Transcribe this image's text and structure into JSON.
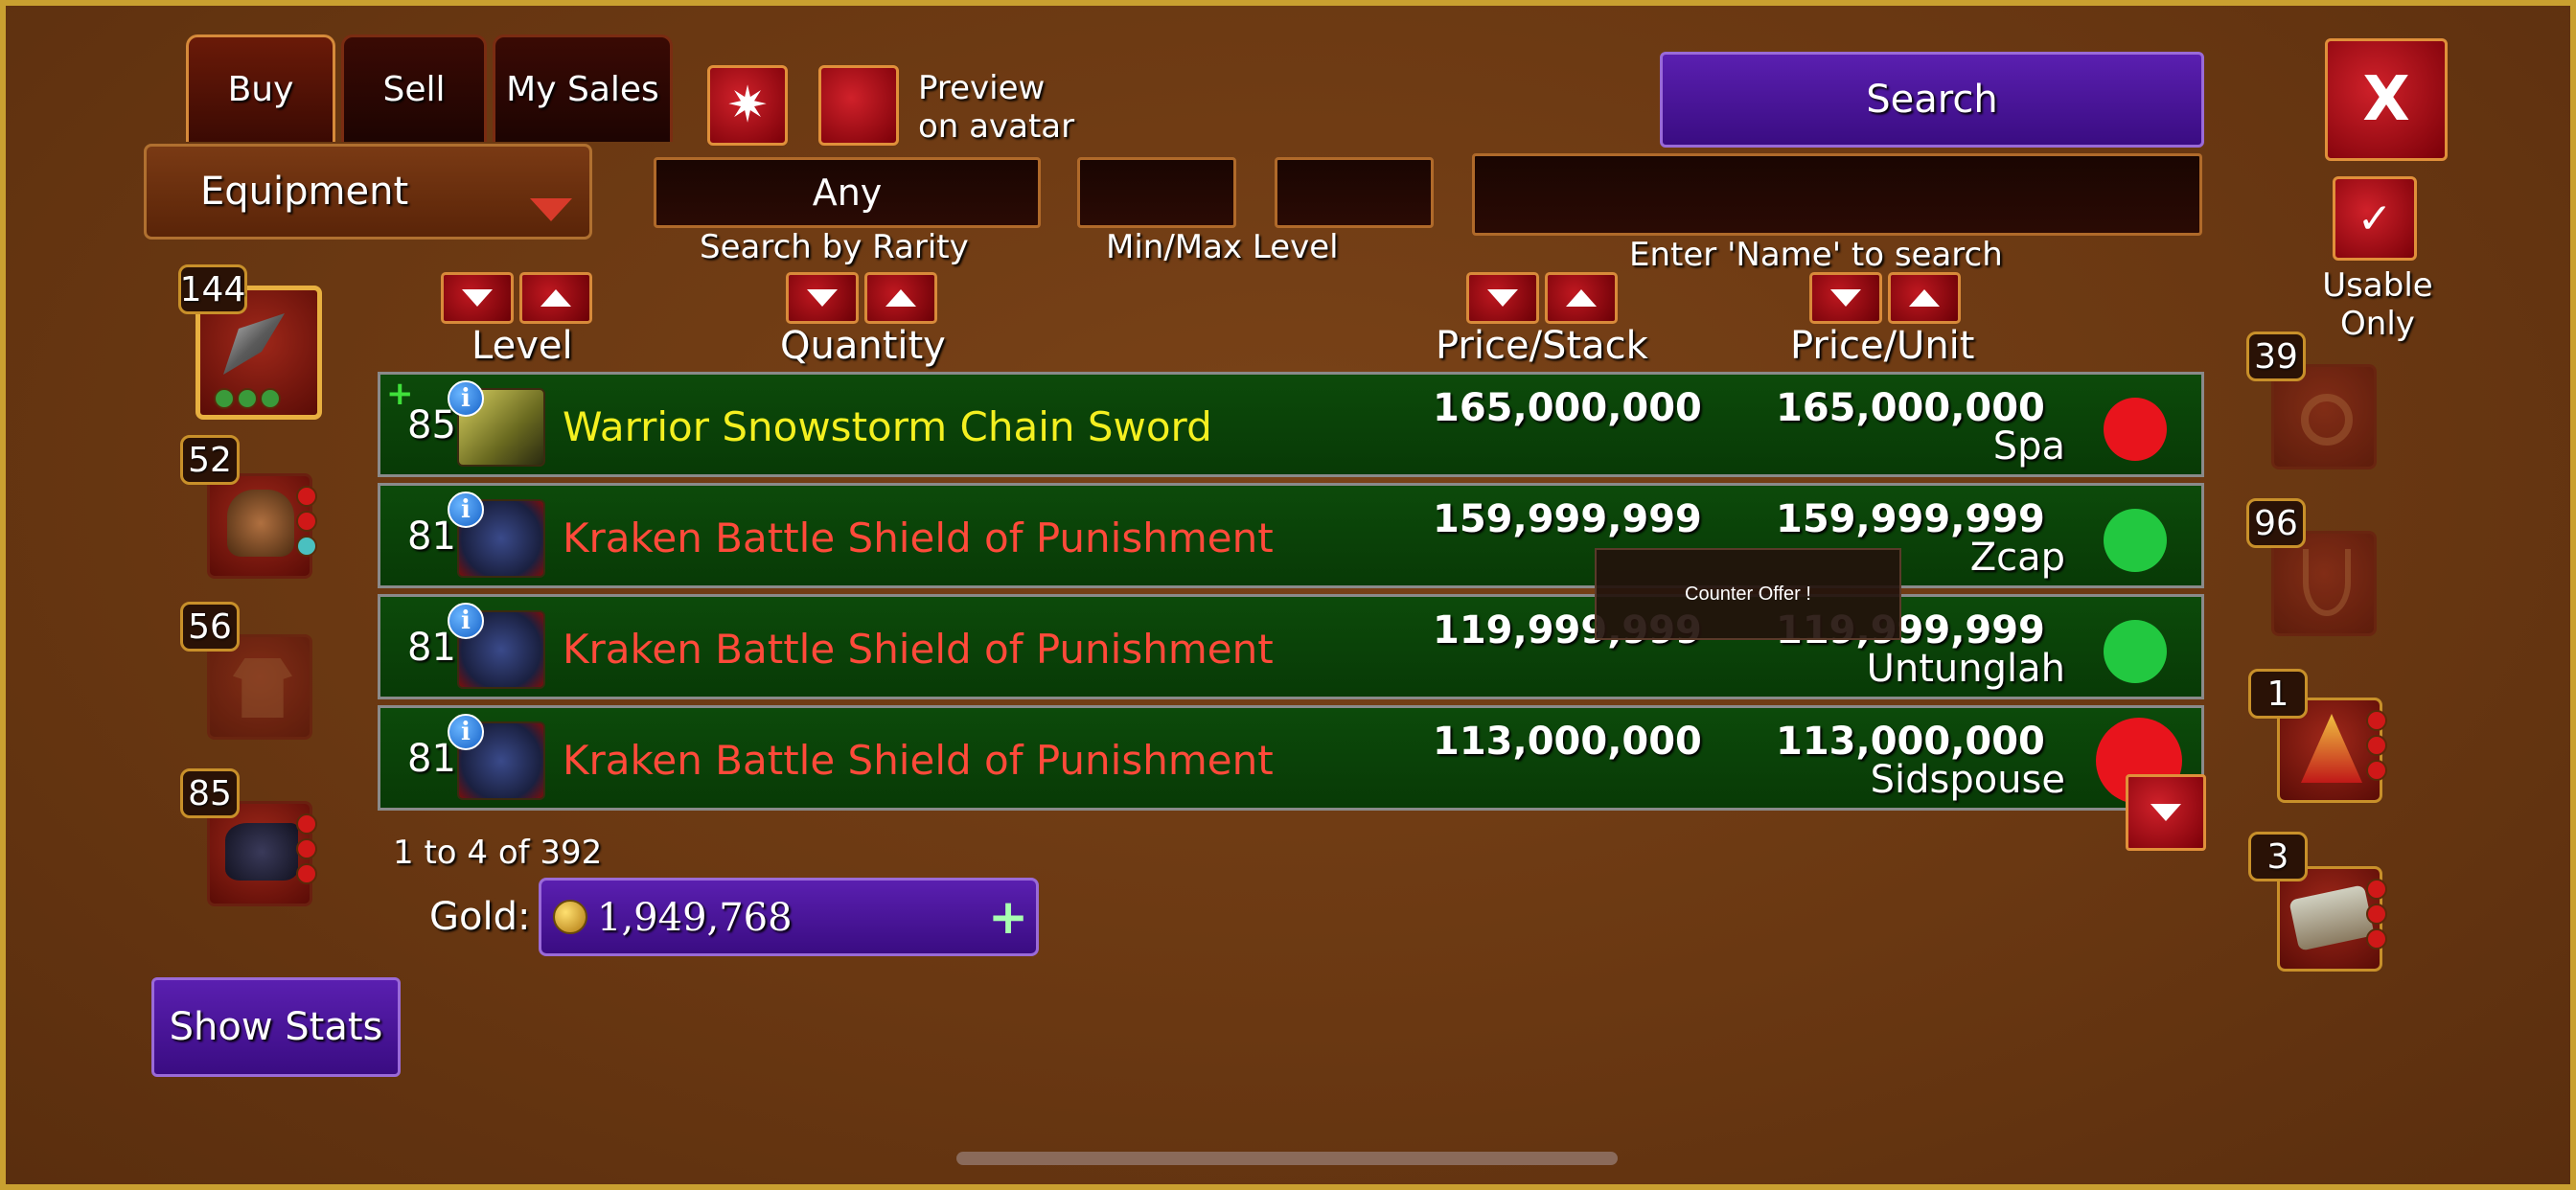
{
  "tabs": [
    {
      "label": "Buy",
      "active": true
    },
    {
      "label": "Sell",
      "active": false
    },
    {
      "label": "My Sales",
      "active": false
    }
  ],
  "preview": {
    "label": "Preview\non avatar"
  },
  "search_button": {
    "label": "Search"
  },
  "close_button": {
    "label": "X"
  },
  "usable_only": {
    "label": "Usable\nOnly",
    "checked": true
  },
  "category_dropdown": {
    "value": "Equipment"
  },
  "filters": {
    "rarity_value": "Any",
    "rarity_label": "Search by Rarity",
    "level_label": "Min/Max Level",
    "name_label": "Enter 'Name' to search",
    "min_level": "",
    "max_level": "",
    "name_value": ""
  },
  "columns": {
    "level": "Level",
    "quantity": "Quantity",
    "price_stack": "Price/Stack",
    "price_unit": "Price/Unit"
  },
  "listings": [
    {
      "level": "85",
      "name": "Warrior Snowstorm Chain Sword",
      "name_color": "#f4f020",
      "price_stack": "165,000,000",
      "price_unit": "165,000,000",
      "seller": "Spa",
      "status_color": "#e8141c",
      "new": true
    },
    {
      "level": "81",
      "name": "Kraken Battle Shield of Punishment",
      "name_color": "#ff4a3a",
      "price_stack": "159,999,999",
      "price_unit": "159,999,999",
      "seller": "Zcap",
      "status_color": "#22c840",
      "new": false
    },
    {
      "level": "81",
      "name": "Kraken Battle Shield of Punishment",
      "name_color": "#ff4a3a",
      "price_stack": "119,999,999",
      "price_unit": "119,999,999",
      "seller": "Untunglah",
      "status_color": "#22c840",
      "new": false
    },
    {
      "level": "81",
      "name": "Kraken Battle Shield of Punishment",
      "name_color": "#ff4a3a",
      "price_stack": "113,000,000",
      "price_unit": "113,000,000",
      "seller": "Sidspouse",
      "status_color": "#e8141c",
      "new": false
    }
  ],
  "tooltip": {
    "text": "Counter Offer !"
  },
  "pagination": {
    "text": "1 to 4 of 392"
  },
  "gold": {
    "label": "Gold:",
    "value": "1,949,768"
  },
  "show_stats": {
    "label": "Show Stats"
  },
  "left_slots": [
    {
      "count": "144",
      "icon": "sword-icon"
    },
    {
      "count": "52",
      "icon": "helmet-icon"
    },
    {
      "count": "56",
      "icon": "armor-icon"
    },
    {
      "count": "85",
      "icon": "boots-icon"
    }
  ],
  "right_slots": [
    {
      "count": "39",
      "icon": "ring-icon"
    },
    {
      "count": "96",
      "icon": "necklace-icon"
    },
    {
      "count": "1",
      "icon": "amulet-icon"
    },
    {
      "count": "3",
      "icon": "bracer-icon"
    }
  ],
  "colors": {
    "background": "#6b3a12",
    "border_gold": "#c9a030",
    "row_green": "#0c4a0a",
    "accent_purple": "#4a16a0",
    "accent_red": "#c01820"
  }
}
